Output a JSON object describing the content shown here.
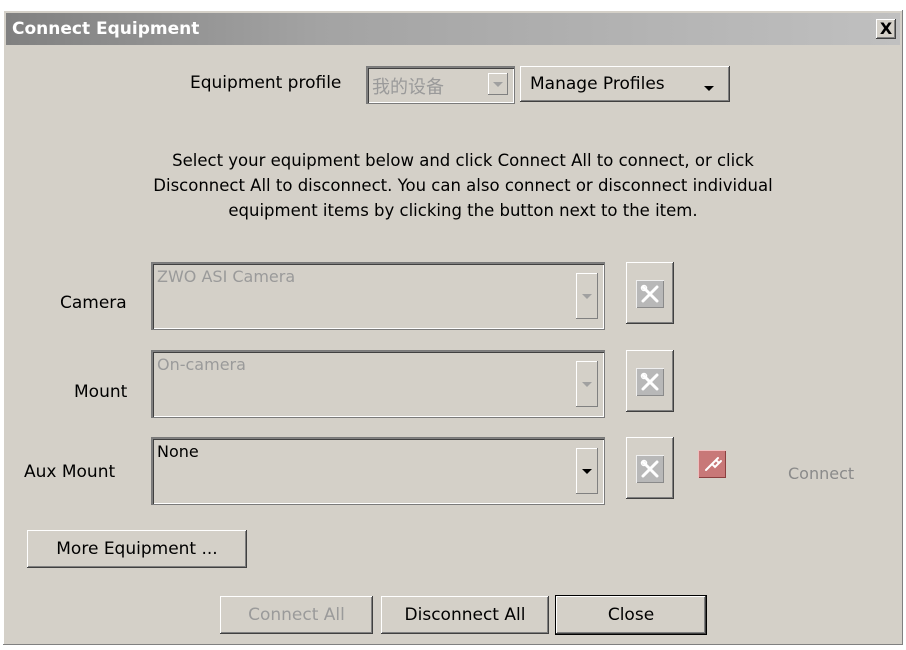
{
  "window": {
    "title": "Connect Equipment",
    "close_label": "X"
  },
  "profile": {
    "label": "Equipment profile",
    "value": "我的设备",
    "manage_label": "Manage Profiles"
  },
  "instructions": "Select your equipment below and click Connect All to connect, or click Disconnect All to disconnect. You can also connect or disconnect individual equipment items by clicking the button next to the item.",
  "equipment": {
    "camera": {
      "label": "Camera",
      "value": "ZWO ASI Camera"
    },
    "mount": {
      "label": "Mount",
      "value": "On-camera"
    },
    "aux_mount": {
      "label": "Aux Mount",
      "value": "None",
      "connect_label": "Connect"
    }
  },
  "buttons": {
    "more_equipment": "More Equipment ...",
    "connect_all": "Connect All",
    "disconnect_all": "Disconnect All",
    "close": "Close"
  },
  "icons": {
    "setup": "tools-icon",
    "connect": "plug-icon"
  }
}
